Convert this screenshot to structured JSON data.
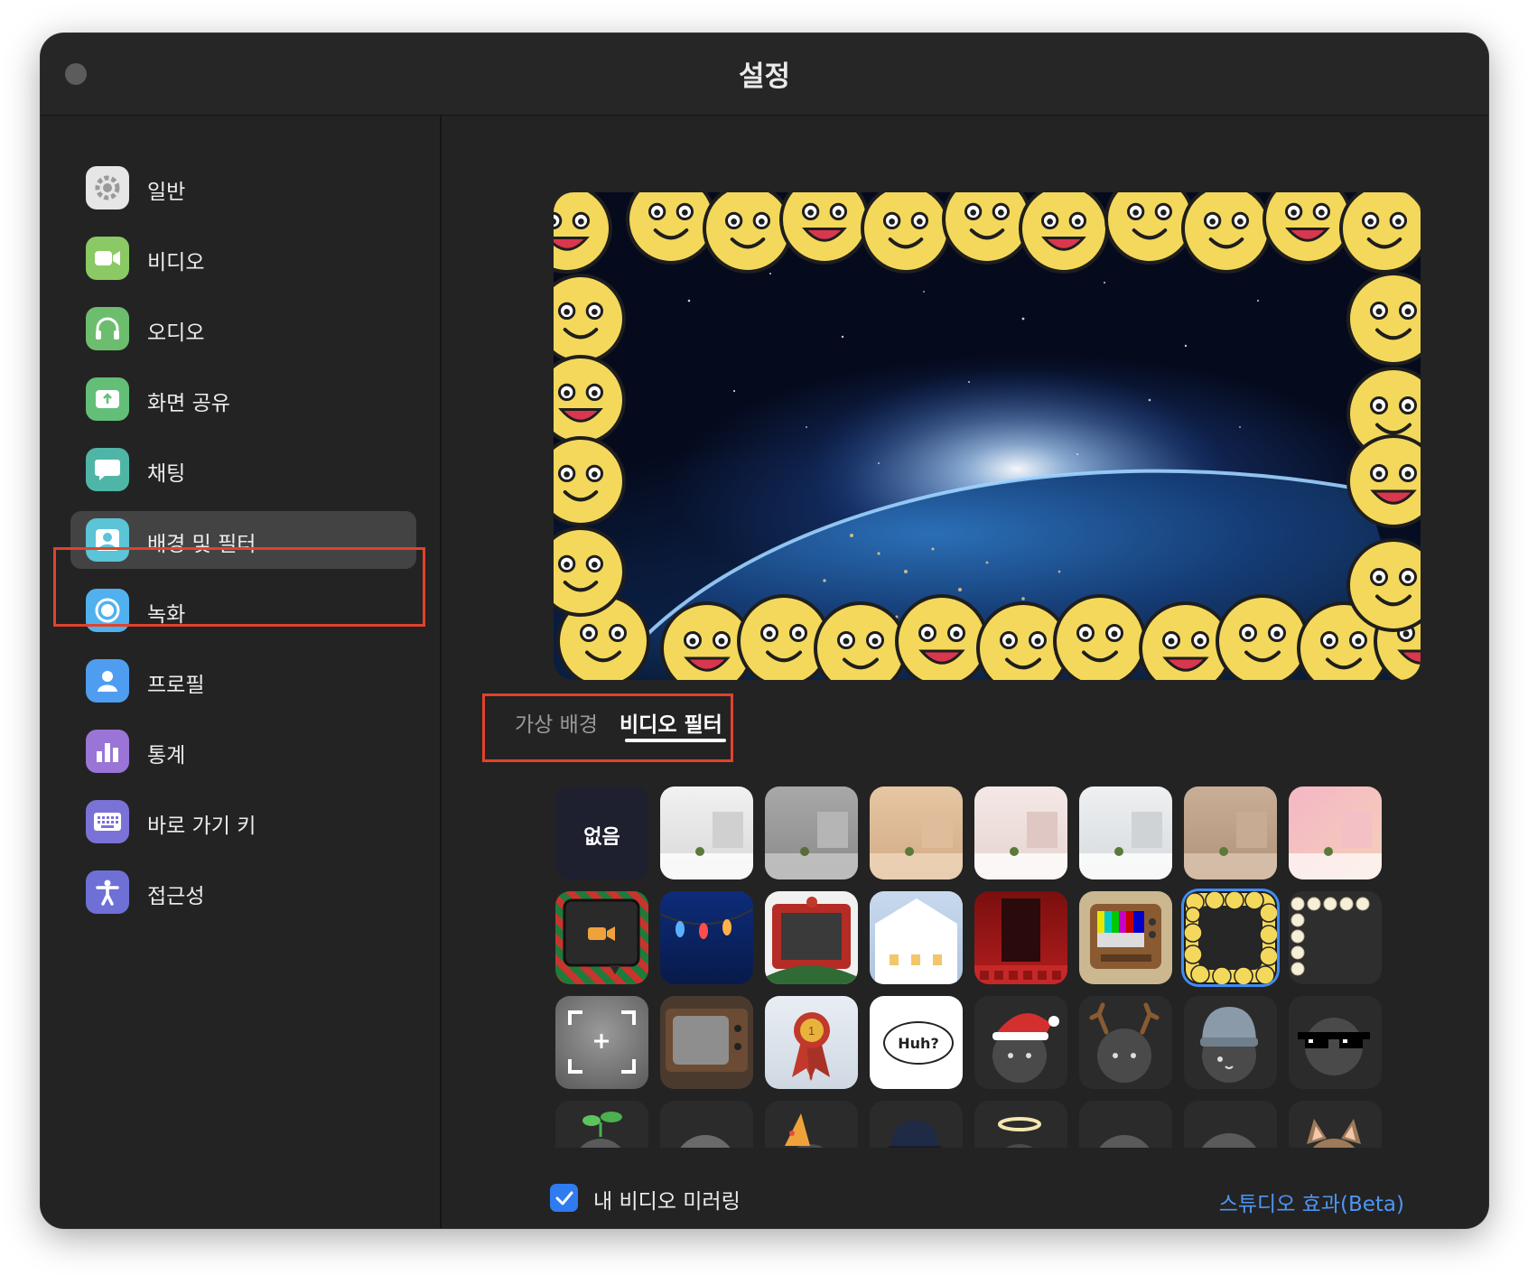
{
  "window": {
    "title": "설정"
  },
  "sidebar": {
    "items": [
      {
        "label": "일반",
        "icon": "gear-icon",
        "color": "#e6e6e6"
      },
      {
        "label": "비디오",
        "icon": "video-camera-icon",
        "color": "#8bc964"
      },
      {
        "label": "오디오",
        "icon": "headphones-icon",
        "color": "#6dbd6e"
      },
      {
        "label": "화면 공유",
        "icon": "screen-share-icon",
        "color": "#63bf78"
      },
      {
        "label": "채팅",
        "icon": "chat-bubble-icon",
        "color": "#4fb6a7"
      },
      {
        "label": "배경 및 필터",
        "icon": "background-person-icon",
        "color": "#5bc4d6"
      },
      {
        "label": "녹화",
        "icon": "record-icon",
        "color": "#51b1ee"
      },
      {
        "label": "프로필",
        "icon": "profile-icon",
        "color": "#4e9df0"
      },
      {
        "label": "통계",
        "icon": "statistics-icon",
        "color": "#9a74d6"
      },
      {
        "label": "바로 가기 키",
        "icon": "keyboard-icon",
        "color": "#7b72d8"
      },
      {
        "label": "접근성",
        "icon": "accessibility-icon",
        "color": "#6e70d6"
      }
    ],
    "active_index": 5
  },
  "tabs": {
    "virtual_background": "가상 배경",
    "video_filter": "비디오 필터",
    "active": "video_filter"
  },
  "filters": {
    "none_label": "없음",
    "huh_label": "Huh?",
    "selected": "emoji-frame",
    "colors": {
      "tile_dark": "#2b2b2b",
      "accent_select": "#3f8cf3",
      "emoji_yellow": "#f4d85b"
    }
  },
  "footer": {
    "mirror_label": "내 비디오 미러링",
    "mirror_checked": true,
    "studio_link": "스튜디오 효과(Beta)"
  }
}
